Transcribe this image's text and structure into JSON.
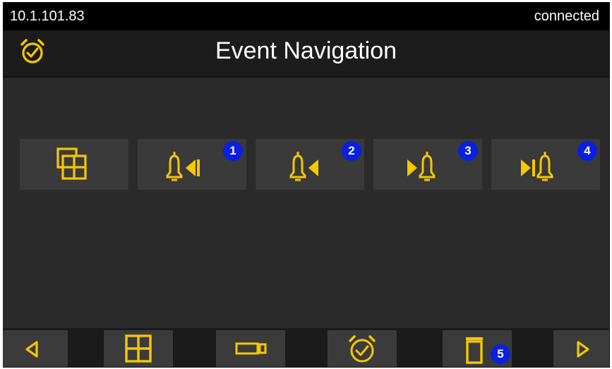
{
  "status": {
    "ip": "10.1.101.83",
    "connection": "connected"
  },
  "header": {
    "title": "Event Navigation",
    "icon": "alarm-clock-icon"
  },
  "nav_buttons": [
    {
      "icon": "multi-view-icon",
      "badge": ""
    },
    {
      "icon": "bell-skip-back-icon",
      "badge": "1"
    },
    {
      "icon": "bell-previous-icon",
      "badge": "2"
    },
    {
      "icon": "bell-next-icon",
      "badge": "3"
    },
    {
      "icon": "bell-skip-forward-icon",
      "badge": "4"
    }
  ],
  "toolbar": [
    {
      "icon": "arrow-left-icon"
    },
    {
      "icon": "grid-layout-icon"
    },
    {
      "icon": "camera-icon"
    },
    {
      "icon": "alarm-clock-icon"
    },
    {
      "icon": "trash-icon",
      "badge": "5"
    },
    {
      "icon": "arrow-right-icon"
    }
  ],
  "colors": {
    "accent": "#f5c800",
    "badge": "#0b1fe0",
    "background": "#2b2b2b",
    "button": "#3a3a3a"
  }
}
